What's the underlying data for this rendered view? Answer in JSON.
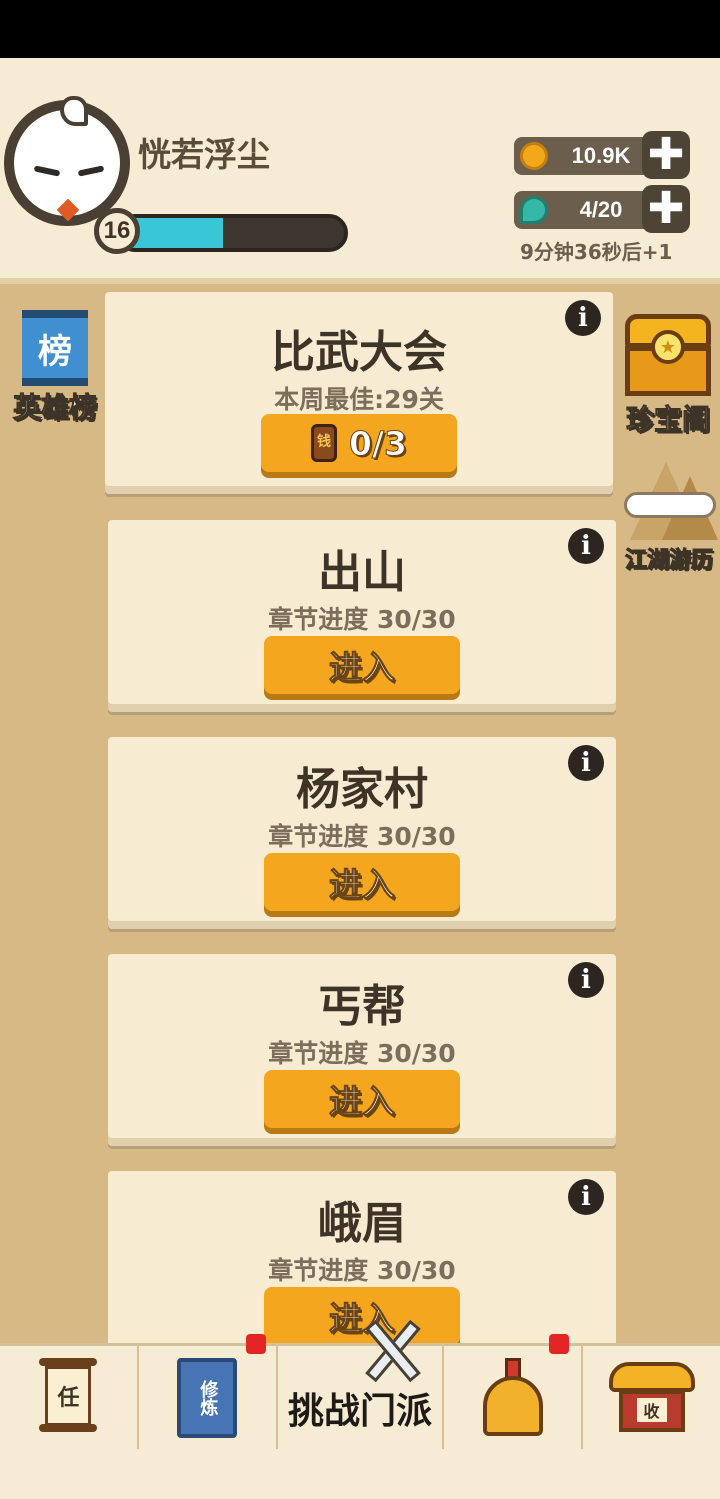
{
  "player": {
    "name": "恍若浮尘",
    "level": "16",
    "xp_fraction": 0.46
  },
  "resources": {
    "coins": "10.9K",
    "stamina": "4/20",
    "regen_text": "9分钟36秒后+1",
    "plus": "✚"
  },
  "sidebar_left": {
    "leaderboard_icon_text": "榜",
    "leaderboard_label": "英雄榜"
  },
  "sidebar_right": {
    "treasure_label": "珍宝阁",
    "travel_label": "江湖游历"
  },
  "tournament": {
    "title": "比武大会",
    "subtitle": "本周最佳:29关",
    "ticket_icon_text": "钱",
    "count": "0/3"
  },
  "stages": [
    {
      "title": "出山",
      "progress": "章节进度 30/30",
      "button": "进入"
    },
    {
      "title": "杨家村",
      "progress": "章节进度 30/30",
      "button": "进入"
    },
    {
      "title": "丐帮",
      "progress": "章节进度 30/30",
      "button": "进入"
    },
    {
      "title": "峨眉",
      "progress": "章节进度 30/30",
      "button": "进入"
    }
  ],
  "info_glyph": "i",
  "bottom_nav": {
    "task_icon_text": "任",
    "train_icon_text": "修炼",
    "center_label": "挑战门派",
    "shop_icon_text": "收"
  },
  "colors": {
    "accent_button": "#f5a61f",
    "xp_bar": "#39c6d6",
    "background": "#d7b985",
    "card": "#f7ebd2",
    "notification": "#e52525"
  }
}
